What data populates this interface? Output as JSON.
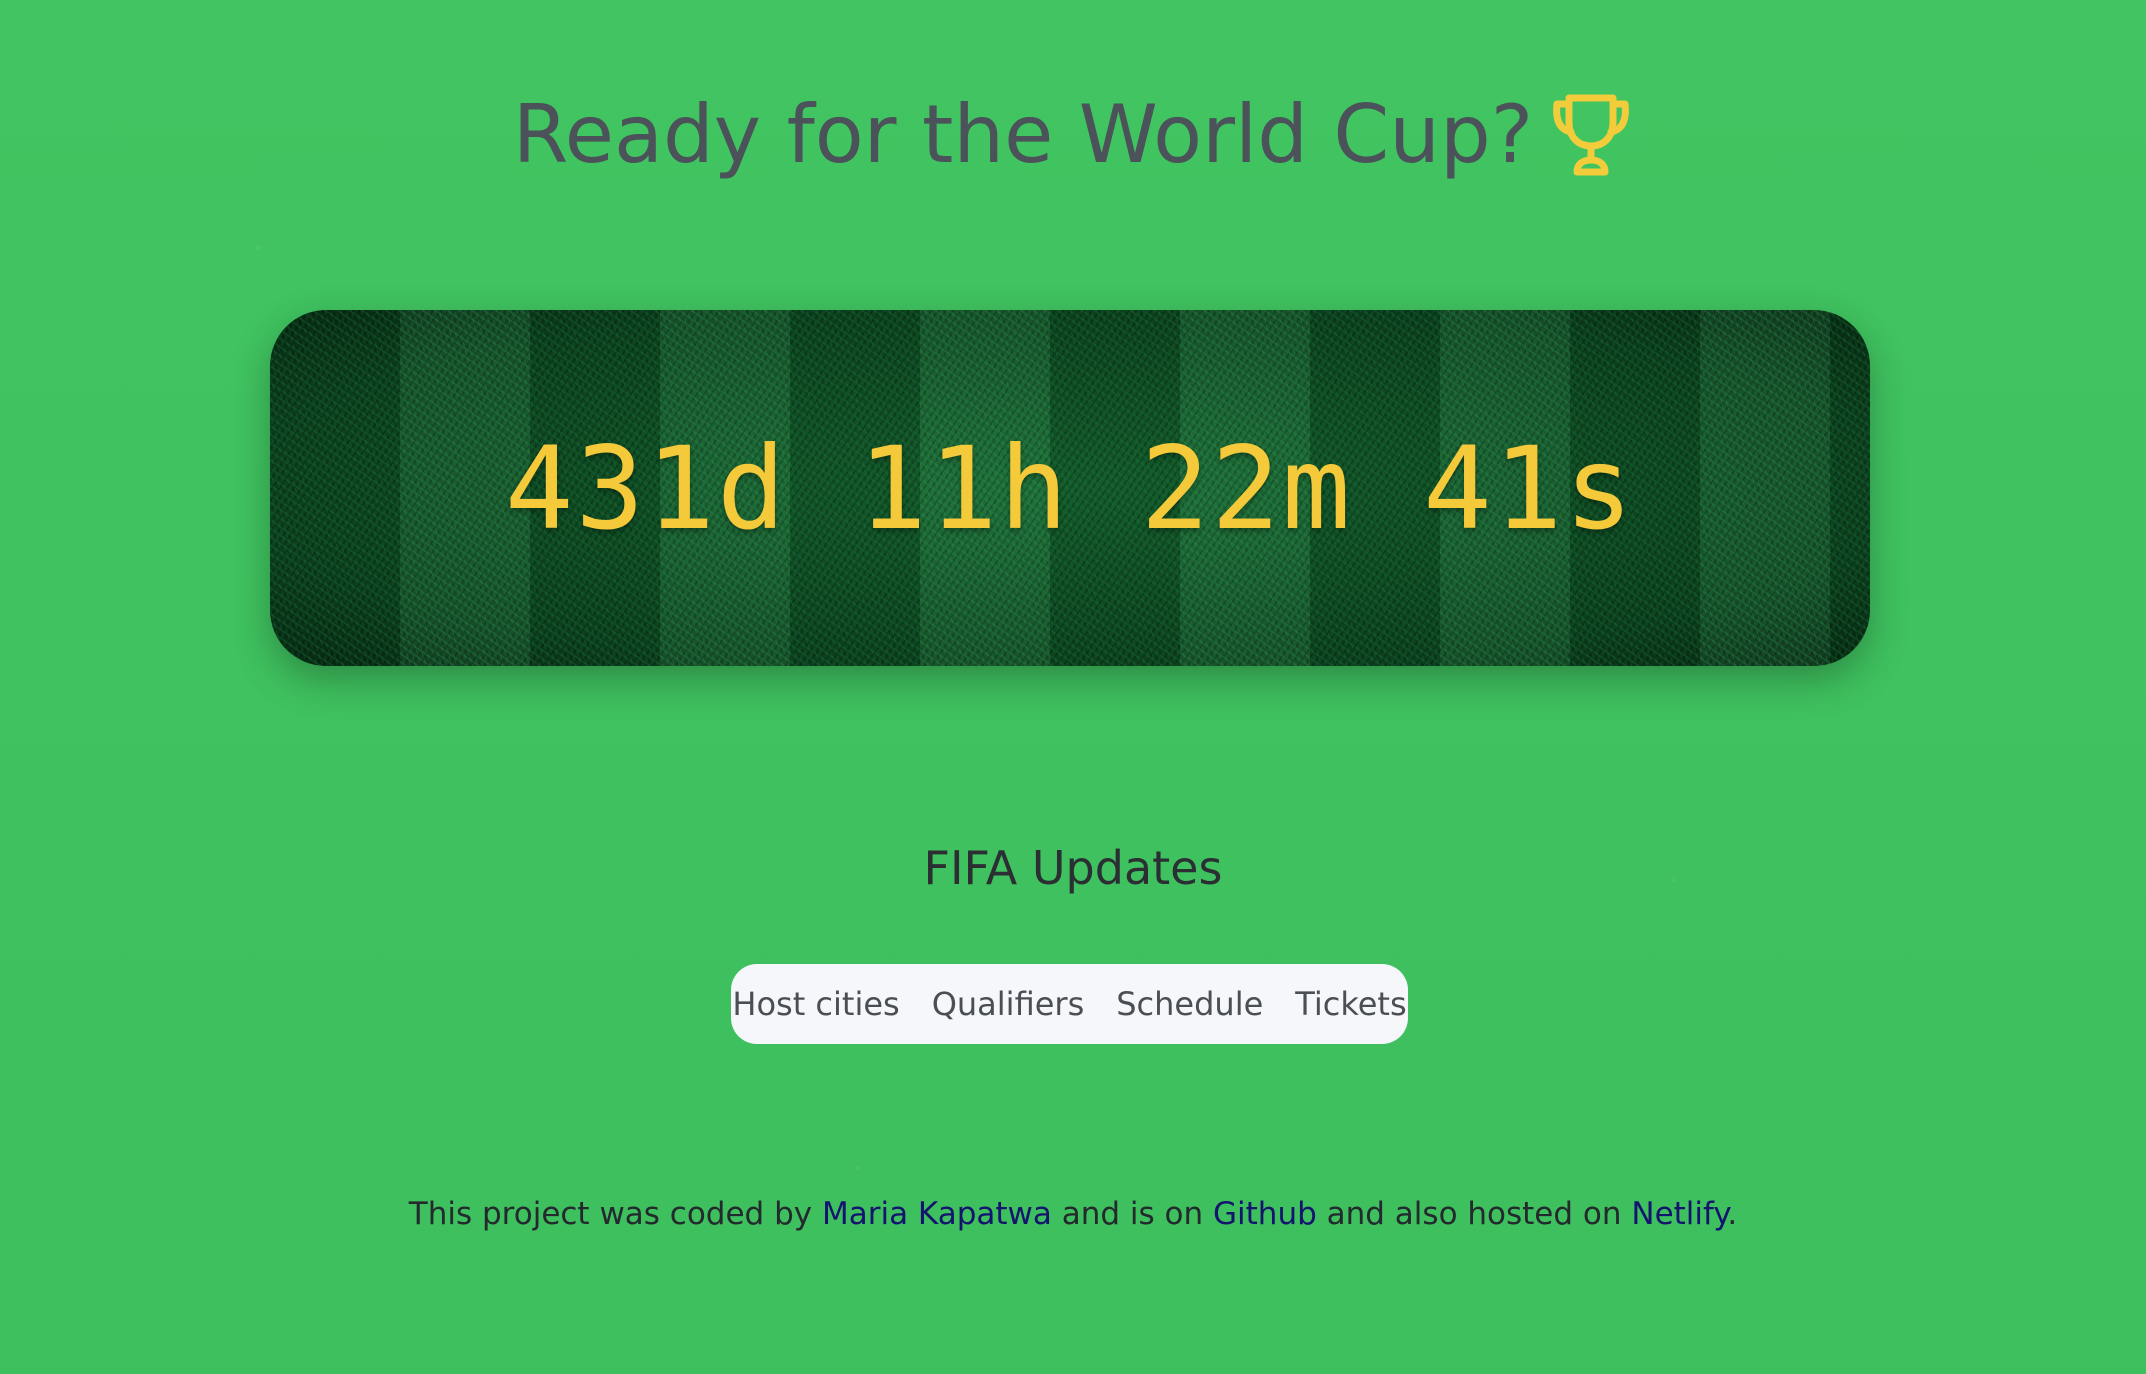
{
  "header": {
    "title": "Ready for the World Cup?",
    "title_icon": "trophy-icon"
  },
  "countdown": {
    "text": "431d 11h 22m 41s",
    "days": 431,
    "hours": 11,
    "minutes": 22,
    "seconds": 41
  },
  "updates": {
    "heading": "FIFA Updates",
    "links": [
      "Host cities",
      "Qualifiers",
      "Schedule",
      "Tickets"
    ]
  },
  "footer": {
    "text_1": "This project was coded by ",
    "author_link": "Maria Kapatwa",
    "text_2": " and is on ",
    "github_link": "Github",
    "text_3": " and also hosted on ",
    "netlify_link": "Netlify",
    "text_4": "."
  },
  "colors": {
    "background": "#3fc25f",
    "countdown_text": "#f4c93a",
    "trophy": "#f2cc3a",
    "link": "#14136e",
    "title": "#4b5259"
  }
}
